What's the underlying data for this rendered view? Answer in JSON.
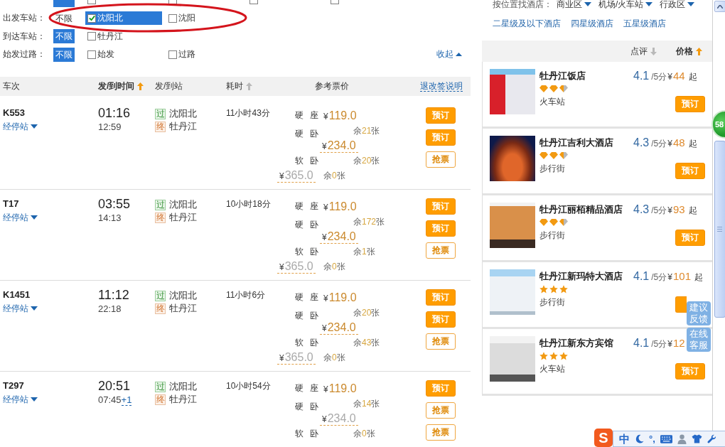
{
  "filters": [
    {
      "options": [
        {
          "kind": "all",
          "selected": true
        },
        {
          "kind": "check",
          "selected": false
        },
        {
          "kind": "check",
          "selected": false
        },
        {
          "kind": "check",
          "selected": false
        },
        {
          "kind": "check",
          "selected": false
        }
      ]
    },
    {
      "label": "出发车站：",
      "options": [
        {
          "kind": "all",
          "label": "不限",
          "selected": false
        },
        {
          "kind": "check",
          "label": "沈阳北",
          "selected": true
        },
        {
          "kind": "check",
          "label": "沈阳",
          "selected": false
        }
      ]
    },
    {
      "label": "到达车站：",
      "options": [
        {
          "kind": "all",
          "label": "不限",
          "selected": true
        },
        {
          "kind": "check",
          "label": "牡丹江",
          "selected": false
        }
      ]
    },
    {
      "label": "始发过路：",
      "options": [
        {
          "kind": "all",
          "label": "不限",
          "selected": true
        },
        {
          "kind": "check",
          "label": "始发",
          "selected": false
        },
        {
          "kind": "check",
          "label": "过路",
          "selected": false
        }
      ]
    }
  ],
  "collapse_link": "收起",
  "table": {
    "columns": [
      {
        "label": "车次"
      },
      {
        "label": "发/到时间",
        "sort": {
          "active": true,
          "ascending": true
        }
      },
      {
        "label": "发/到站"
      },
      {
        "label": "耗时",
        "sort": {
          "active": false,
          "ascending": true
        }
      },
      {
        "label": "参考票价"
      }
    ],
    "refund_link": "退改签说明",
    "rows": [
      {
        "train": "K553",
        "stops_link": "经停站",
        "depart": "01:16",
        "arrive": "12:59",
        "stations": [
          {
            "kind": "pass",
            "badge": "过",
            "name": "沈阳北"
          },
          {
            "kind": "end",
            "badge": "终",
            "name": "牡丹江"
          }
        ],
        "duration": "11小时43分",
        "seats": [
          {
            "name": "硬 座",
            "currency": "¥",
            "price": "119.0",
            "available": true,
            "remaining": {
              "prefix": "余",
              "count": "21",
              "unit": "张"
            },
            "button": "预订"
          },
          {
            "name": "硬 卧",
            "currency": "¥",
            "price": "234.0",
            "available": true,
            "remaining": {
              "prefix": "余",
              "count": "20",
              "unit": "张"
            },
            "button": "预订"
          },
          {
            "name": "软 卧",
            "currency": "¥",
            "price": "365.0",
            "available": false,
            "remaining": {
              "prefix": "余",
              "count": "0",
              "unit": "张"
            },
            "button": "抢票"
          }
        ]
      },
      {
        "train": "T17",
        "stops_link": "经停站",
        "depart": "03:55",
        "arrive": "14:13",
        "stations": [
          {
            "kind": "pass",
            "badge": "过",
            "name": "沈阳北"
          },
          {
            "kind": "end",
            "badge": "终",
            "name": "牡丹江"
          }
        ],
        "duration": "10小时18分",
        "seats": [
          {
            "name": "硬 座",
            "currency": "¥",
            "price": "119.0",
            "available": true,
            "remaining": {
              "prefix": "余",
              "count": "172",
              "unit": "张"
            },
            "button": "预订"
          },
          {
            "name": "硬 卧",
            "currency": "¥",
            "price": "234.0",
            "available": true,
            "remaining": {
              "prefix": "余",
              "count": "1",
              "unit": "张"
            },
            "button": "预订"
          },
          {
            "name": "软 卧",
            "currency": "¥",
            "price": "365.0",
            "available": false,
            "remaining": {
              "prefix": "余",
              "count": "0",
              "unit": "张"
            },
            "button": "抢票"
          }
        ]
      },
      {
        "train": "K1451",
        "stops_link": "经停站",
        "depart": "11:12",
        "arrive": "22:18",
        "stations": [
          {
            "kind": "pass",
            "badge": "过",
            "name": "沈阳北"
          },
          {
            "kind": "end",
            "badge": "终",
            "name": "牡丹江"
          }
        ],
        "duration": "11小时6分",
        "seats": [
          {
            "name": "硬 座",
            "currency": "¥",
            "price": "119.0",
            "available": true,
            "remaining": {
              "prefix": "余",
              "count": "20",
              "unit": "张"
            },
            "button": "预订"
          },
          {
            "name": "硬 卧",
            "currency": "¥",
            "price": "234.0",
            "available": true,
            "remaining": {
              "prefix": "余",
              "count": "43",
              "unit": "张"
            },
            "button": "预订"
          },
          {
            "name": "软 卧",
            "currency": "¥",
            "price": "365.0",
            "available": false,
            "remaining": {
              "prefix": "余",
              "count": "0",
              "unit": "张"
            },
            "button": "抢票"
          }
        ]
      },
      {
        "train": "T297",
        "stops_link": "经停站",
        "depart": "20:51",
        "arrive": "07:45",
        "day_offset": "+1",
        "stations": [
          {
            "kind": "pass",
            "badge": "过",
            "name": "沈阳北"
          },
          {
            "kind": "end",
            "badge": "终",
            "name": "牡丹江"
          }
        ],
        "duration": "10小时54分",
        "seats": [
          {
            "name": "硬 座",
            "currency": "¥",
            "price": "119.0",
            "available": true,
            "remaining": {
              "prefix": "余",
              "count": "14",
              "unit": "张"
            },
            "button": "预订"
          },
          {
            "name": "硬 卧",
            "currency": "¥",
            "price": "234.0",
            "available": false,
            "remaining": {
              "prefix": "余",
              "count": "0",
              "unit": "张"
            },
            "button": "抢票"
          },
          {
            "name": "软 卧",
            "available": false,
            "button": "抢票"
          }
        ]
      }
    ]
  },
  "hotels_panel": {
    "location_filter": {
      "label": "按位置找酒店：",
      "dropdowns": [
        "商业区",
        "机场/火车站",
        "行政区"
      ]
    },
    "grade_links": [
      "二星级及以下酒店",
      "四星级酒店",
      "五星级酒店"
    ],
    "sort": [
      {
        "label": "点评",
        "active": false,
        "ascending": false
      },
      {
        "label": "价格",
        "active": true,
        "ascending": true
      }
    ],
    "hotels": [
      {
        "name": "牡丹江饭店",
        "rating": "4.1",
        "scale": "/5分",
        "currency": "¥",
        "price": "44",
        "suffix": "起",
        "kind": "diamond",
        "stars": 2.5,
        "area": "火车站",
        "button": "预订"
      },
      {
        "name": "牡丹江吉利大酒店",
        "rating": "4.3",
        "scale": "/5分",
        "currency": "¥",
        "price": "48",
        "suffix": "起",
        "kind": "diamond",
        "stars": 2.5,
        "area": "步行街",
        "button": "预订"
      },
      {
        "name": "牡丹江丽栢精品酒店",
        "rating": "4.3",
        "scale": "/5分",
        "currency": "¥",
        "price": "93",
        "suffix": "起",
        "kind": "diamond",
        "stars": 2.5,
        "area": "步行街",
        "button": "预订"
      },
      {
        "name": "牡丹江新玛特大酒店",
        "rating": "4.1",
        "scale": "/5分",
        "currency": "¥",
        "price": "101",
        "suffix": "起",
        "kind": "star",
        "stars": 3,
        "area": "步行街"
      },
      {
        "name": "牡丹江新东方宾馆",
        "rating": "4.1",
        "scale": "/5分",
        "currency": "¥",
        "price": "12",
        "kind": "star",
        "stars": 3,
        "area": "火车站",
        "button": "预订"
      }
    ]
  },
  "float_buttons": [
    "建议反馈",
    "在线客服"
  ],
  "badge": "58",
  "ime_toolbar": {
    "logo": "S",
    "mode": "中",
    "punctuation": "°,"
  }
}
